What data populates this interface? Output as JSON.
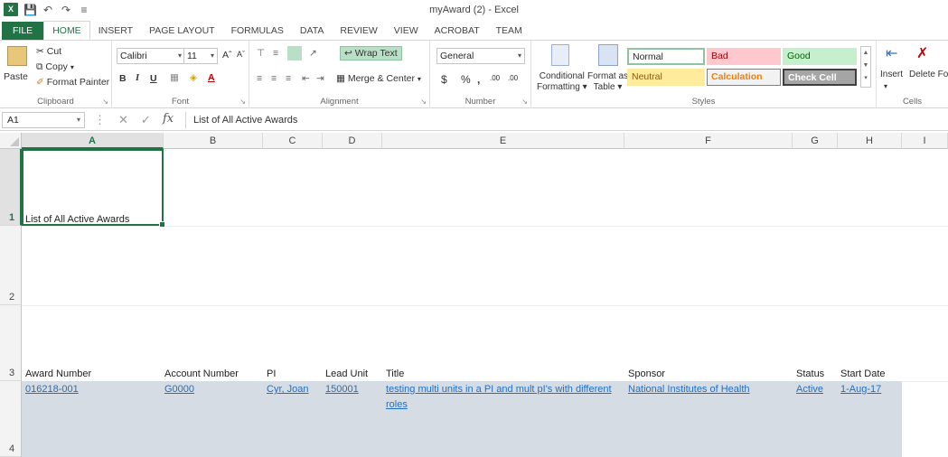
{
  "window": {
    "title": "myAward (2) - Excel"
  },
  "tabs": [
    "FILE",
    "HOME",
    "INSERT",
    "PAGE LAYOUT",
    "FORMULAS",
    "DATA",
    "REVIEW",
    "VIEW",
    "ACROBAT",
    "TEAM"
  ],
  "ribbon": {
    "clipboard": {
      "label": "Clipboard",
      "paste": "Paste",
      "cut": "Cut",
      "copy": "Copy",
      "format_painter": "Format Painter"
    },
    "font": {
      "label": "Font",
      "name": "Calibri",
      "size": "11",
      "bold": "B",
      "italic": "I",
      "underline": "U"
    },
    "alignment": {
      "label": "Alignment",
      "wrap_text": "Wrap Text",
      "merge_center": "Merge & Center"
    },
    "number": {
      "label": "Number",
      "format": "General",
      "currency": "$",
      "percent": "%",
      "comma": ",",
      "inc_decimal": ".00",
      "dec_decimal": ".00"
    },
    "styles": {
      "label": "Styles",
      "conditional_formatting_1": "Conditional",
      "conditional_formatting_2": "Formatting",
      "format_as_table_1": "Format as",
      "format_as_table_2": "Table",
      "normal": "Normal",
      "bad": "Bad",
      "good": "Good",
      "neutral": "Neutral",
      "calculation": "Calculation",
      "check_cell": "Check Cell"
    },
    "cells": {
      "label": "Cells",
      "insert": "Insert",
      "delete": "Delete Fo"
    }
  },
  "formula_bar": {
    "name_box": "A1",
    "fx": "fx",
    "value": "List of All Active Awards"
  },
  "columns": [
    "A",
    "B",
    "C",
    "D",
    "E",
    "F",
    "G",
    "H",
    "I"
  ],
  "rows": [
    "1",
    "2",
    "3",
    "4"
  ],
  "sheet": {
    "a1": "List of All Active Awards",
    "headers": [
      "Award Number",
      "Account Number",
      "PI",
      "Lead Unit",
      "Title",
      "Sponsor",
      "Status",
      "Start Date"
    ],
    "record": {
      "award_number": "016218-001",
      "account_number": "G0000",
      "pi": "Cyr, Joan",
      "lead_unit": "150001",
      "title_line1": "testing multi units in a PI and mult pI's with different",
      "title_line2": "roles",
      "sponsor": "National Institutes of Health",
      "status": "Active",
      "start_date": "1-Aug-17"
    }
  },
  "colors": {
    "excel_green": "#217346",
    "link_blue": "#1f6fc5",
    "row_band": "#d6dce4"
  }
}
